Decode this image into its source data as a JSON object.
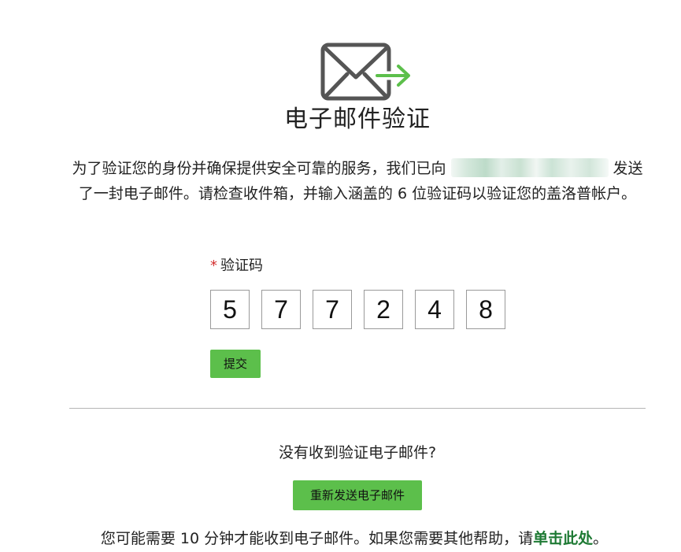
{
  "page": {
    "title": "电子邮件验证",
    "icon": "envelope-arrow-icon",
    "icon_color": "#555555",
    "arrow_color": "#5cbf4b"
  },
  "intro": {
    "before_email": "为了验证您的身份并确保提供安全可靠的服务，我们已向",
    "after_email": "发送了一封电子邮件。请检查收件箱，并输入涵盖的 6 位验证码以验证您的盖洛普帐户。"
  },
  "form": {
    "required_mark": "*",
    "code_label": "验证码",
    "code_digits": [
      "5",
      "7",
      "7",
      "2",
      "4",
      "8"
    ],
    "submit_label": "提交"
  },
  "resend": {
    "question": "没有收到验证电子邮件?",
    "button_label": "重新发送电子邮件"
  },
  "help": {
    "text": "您可能需要 10 分钟才能收到电子邮件。如果您需要其他帮助，请",
    "link_label": "单击此处",
    "end_punct": "。"
  },
  "colors": {
    "accent": "#5cbf4b",
    "link": "#1e7a34",
    "required": "#d32f2f"
  }
}
